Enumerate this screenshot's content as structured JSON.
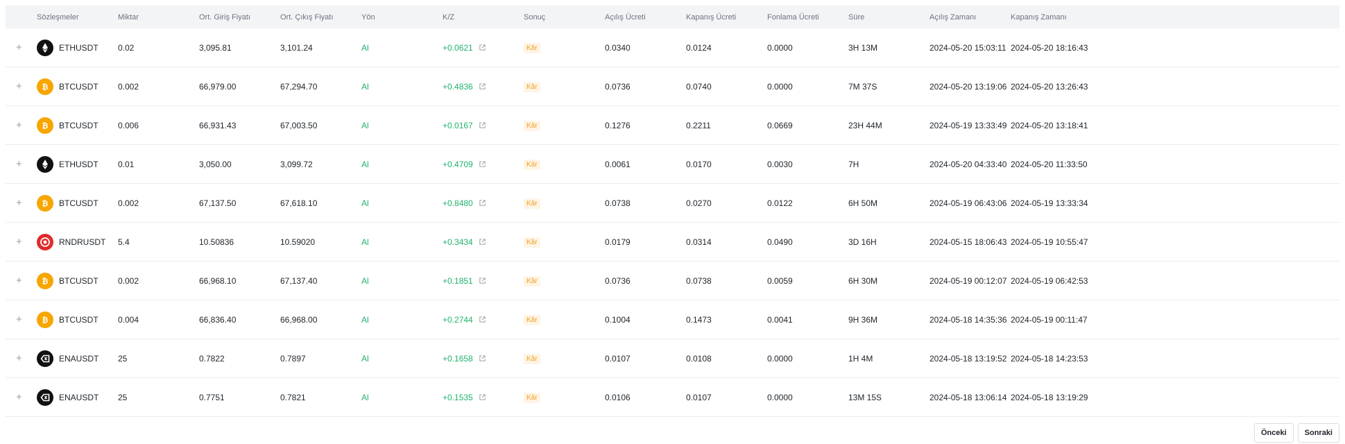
{
  "columns": [
    "Sözleşmeler",
    "Miktar",
    "Ort. Giriş Fiyatı",
    "Ort. Çıkış Fiyatı",
    "Yön",
    "K/Z",
    "Sonuç",
    "Açılış Ücreti",
    "Kapanış Ücreti",
    "Fonlama Ücreti",
    "Süre",
    "Açılış Zamanı",
    "Kapanış Zamanı"
  ],
  "rows": [
    {
      "icon": "eth-icon",
      "contract": "ETHUSDT",
      "qty": "0.02",
      "entry": "3,095.81",
      "exit": "3,101.24",
      "side": "Al",
      "pnl": "+0.0621",
      "result": "Kâr",
      "open_fee": "0.0340",
      "close_fee": "0.0124",
      "funding": "0.0000",
      "duration": "3H 13M",
      "open_time": "2024-05-20 15:03:11",
      "close_time": "2024-05-20 18:16:43"
    },
    {
      "icon": "btc-icon",
      "contract": "BTCUSDT",
      "qty": "0.002",
      "entry": "66,979.00",
      "exit": "67,294.70",
      "side": "Al",
      "pnl": "+0.4836",
      "result": "Kâr",
      "open_fee": "0.0736",
      "close_fee": "0.0740",
      "funding": "0.0000",
      "duration": "7M 37S",
      "open_time": "2024-05-20 13:19:06",
      "close_time": "2024-05-20 13:26:43"
    },
    {
      "icon": "btc-icon",
      "contract": "BTCUSDT",
      "qty": "0.006",
      "entry": "66,931.43",
      "exit": "67,003.50",
      "side": "Al",
      "pnl": "+0.0167",
      "result": "Kâr",
      "open_fee": "0.1276",
      "close_fee": "0.2211",
      "funding": "0.0669",
      "duration": "23H 44M",
      "open_time": "2024-05-19 13:33:49",
      "close_time": "2024-05-20 13:18:41"
    },
    {
      "icon": "eth-icon",
      "contract": "ETHUSDT",
      "qty": "0.01",
      "entry": "3,050.00",
      "exit": "3,099.72",
      "side": "Al",
      "pnl": "+0.4709",
      "result": "Kâr",
      "open_fee": "0.0061",
      "close_fee": "0.0170",
      "funding": "0.0030",
      "duration": "7H",
      "open_time": "2024-05-20 04:33:40",
      "close_time": "2024-05-20 11:33:50"
    },
    {
      "icon": "btc-icon",
      "contract": "BTCUSDT",
      "qty": "0.002",
      "entry": "67,137.50",
      "exit": "67,618.10",
      "side": "Al",
      "pnl": "+0.8480",
      "result": "Kâr",
      "open_fee": "0.0738",
      "close_fee": "0.0270",
      "funding": "0.0122",
      "duration": "6H 50M",
      "open_time": "2024-05-19 06:43:06",
      "close_time": "2024-05-19 13:33:34"
    },
    {
      "icon": "rndr-icon",
      "contract": "RNDRUSDT",
      "qty": "5.4",
      "entry": "10.50836",
      "exit": "10.59020",
      "side": "Al",
      "pnl": "+0.3434",
      "result": "Kâr",
      "open_fee": "0.0179",
      "close_fee": "0.0314",
      "funding": "0.0490",
      "duration": "3D 16H",
      "open_time": "2024-05-15 18:06:43",
      "close_time": "2024-05-19 10:55:47"
    },
    {
      "icon": "btc-icon",
      "contract": "BTCUSDT",
      "qty": "0.002",
      "entry": "66,968.10",
      "exit": "67,137.40",
      "side": "Al",
      "pnl": "+0.1851",
      "result": "Kâr",
      "open_fee": "0.0736",
      "close_fee": "0.0738",
      "funding": "0.0059",
      "duration": "6H 30M",
      "open_time": "2024-05-19 00:12:07",
      "close_time": "2024-05-19 06:42:53"
    },
    {
      "icon": "btc-icon",
      "contract": "BTCUSDT",
      "qty": "0.004",
      "entry": "66,836.40",
      "exit": "66,968.00",
      "side": "Al",
      "pnl": "+0.2744",
      "result": "Kâr",
      "open_fee": "0.1004",
      "close_fee": "0.1473",
      "funding": "0.0041",
      "duration": "9H 36M",
      "open_time": "2024-05-18 14:35:36",
      "close_time": "2024-05-19 00:11:47"
    },
    {
      "icon": "ena-icon",
      "contract": "ENAUSDT",
      "qty": "25",
      "entry": "0.7822",
      "exit": "0.7897",
      "side": "Al",
      "pnl": "+0.1658",
      "result": "Kâr",
      "open_fee": "0.0107",
      "close_fee": "0.0108",
      "funding": "0.0000",
      "duration": "1H 4M",
      "open_time": "2024-05-18 13:19:52",
      "close_time": "2024-05-18 14:23:53"
    },
    {
      "icon": "ena-icon",
      "contract": "ENAUSDT",
      "qty": "25",
      "entry": "0.7751",
      "exit": "0.7821",
      "side": "Al",
      "pnl": "+0.1535",
      "result": "Kâr",
      "open_fee": "0.0106",
      "close_fee": "0.0107",
      "funding": "0.0000",
      "duration": "13M 15S",
      "open_time": "2024-05-18 13:06:14",
      "close_time": "2024-05-18 13:19:29"
    }
  ],
  "pagination": {
    "prev_label": "Önceki",
    "next_label": "Sonraki"
  },
  "colors": {
    "profit": "#20b26c",
    "badge_bg": "#fff4e5",
    "badge_text": "#f0a020",
    "btc": "#f7a600",
    "rndr": "#e12a2a",
    "header_bg": "#f3f4f6"
  }
}
